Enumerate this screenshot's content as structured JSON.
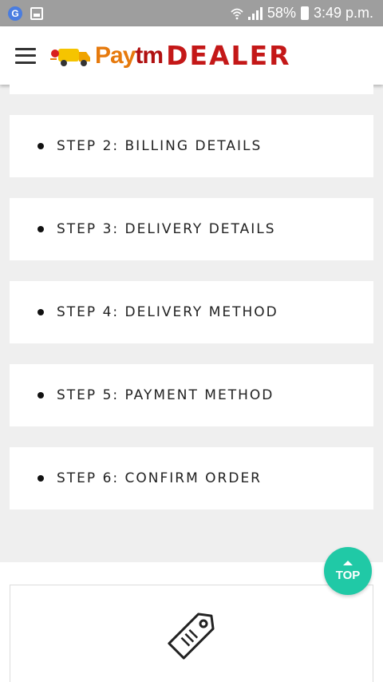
{
  "status_bar": {
    "battery": "58%",
    "time": "3:49 p.m.",
    "icons": [
      "g-icon",
      "image-icon",
      "wifi-icon",
      "signal-icon",
      "battery-icon"
    ]
  },
  "header": {
    "logo_paytm_prefix": "Pay",
    "logo_paytm_suffix": "tm",
    "logo_dealer": "DEALER",
    "menu_icon": "hamburger-icon"
  },
  "steps": [
    {
      "label": "STEP 2: BILLING DETAILS"
    },
    {
      "label": "STEP 3: DELIVERY DETAILS"
    },
    {
      "label": "STEP 4: DELIVERY METHOD"
    },
    {
      "label": "STEP 5: PAYMENT METHOD"
    },
    {
      "label": "STEP 6: CONFIRM ORDER"
    }
  ],
  "top_button": {
    "label": "TOP"
  },
  "colors": {
    "accent": "#20c9a6",
    "brand_red": "#c41818",
    "brand_orange": "#e67a0d"
  }
}
